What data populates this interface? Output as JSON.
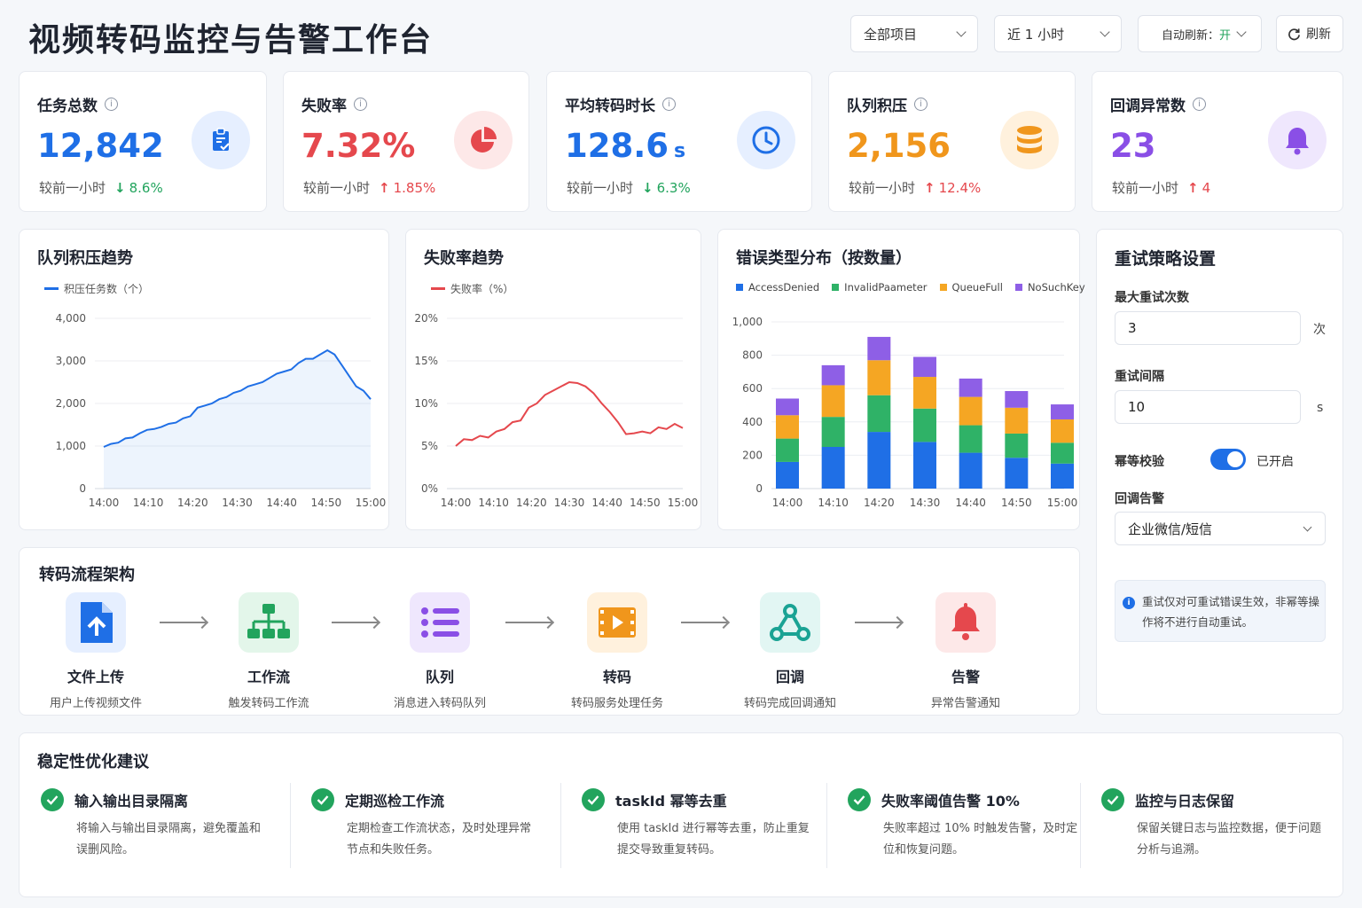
{
  "header": {
    "title": "视频转码监控与告警工作台",
    "project_select": "全部项目",
    "range_select": "近 1 小时",
    "auto_refresh_label": "自动刷新：",
    "auto_refresh_value": "开",
    "refresh_button": "刷新"
  },
  "kpis": [
    {
      "label": "任务总数",
      "value": "12,842",
      "unit": "",
      "compare": "较前一小时",
      "delta": "8.6%",
      "dir": "down",
      "color": "#1f6fe6",
      "delta_color": "#22a45d",
      "icon": "clipboard-check-icon",
      "icon_bg": "#e6efff"
    },
    {
      "label": "失败率",
      "value": "7.32%",
      "unit": "",
      "compare": "较前一小时",
      "delta": "1.85%",
      "dir": "up",
      "color": "#e5484d",
      "delta_color": "#e5484d",
      "icon": "pie-chart-icon",
      "icon_bg": "#fde8e8"
    },
    {
      "label": "平均转码时长",
      "value": "128.6",
      "unit": "s",
      "compare": "较前一小时",
      "delta": "6.3%",
      "dir": "down",
      "color": "#1f6fe6",
      "delta_color": "#22a45d",
      "icon": "clock-icon",
      "icon_bg": "#e6efff"
    },
    {
      "label": "队列积压",
      "value": "2,156",
      "unit": "",
      "compare": "较前一小时",
      "delta": "12.4%",
      "dir": "up",
      "color": "#f0961c",
      "delta_color": "#e5484d",
      "icon": "database-icon",
      "icon_bg": "#fff1dd"
    },
    {
      "label": "回调异常数",
      "value": "23",
      "unit": "",
      "compare": "较前一小时",
      "delta": "4",
      "dir": "up",
      "color": "#8a4fe6",
      "delta_color": "#e5484d",
      "icon": "bell-icon",
      "icon_bg": "#efe7fd"
    }
  ],
  "chart_data": [
    {
      "type": "area",
      "title": "队列积压趋势",
      "series": [
        {
          "name": "积压任务数（个）",
          "color": "#1f6fe6",
          "values": [
            980,
            1050,
            1080,
            1180,
            1200,
            1300,
            1380,
            1400,
            1450,
            1520,
            1550,
            1650,
            1700,
            1900,
            1950,
            2000,
            2100,
            2150,
            2250,
            2300,
            2400,
            2450,
            2500,
            2600,
            2700,
            2750,
            2800,
            2950,
            3050,
            3050,
            3150,
            3250,
            3150,
            2900,
            2650,
            2400,
            2300,
            2100
          ]
        }
      ],
      "x_ticks": [
        "14:00",
        "14:10",
        "14:20",
        "14:30",
        "14:40",
        "14:50",
        "15:00"
      ],
      "y_ticks": [
        "4,000",
        "3,000",
        "2,000",
        "1,000",
        "0"
      ],
      "ylim": [
        0,
        4000
      ]
    },
    {
      "type": "line",
      "title": "失败率趋势",
      "series": [
        {
          "name": "失败率（%）",
          "color": "#e5484d",
          "values": [
            5.0,
            5.8,
            5.7,
            6.2,
            6.0,
            6.7,
            7.0,
            7.8,
            8.0,
            9.5,
            10.0,
            11.0,
            11.5,
            12.0,
            12.5,
            12.4,
            12.0,
            11.2,
            10.0,
            9.0,
            7.8,
            6.4,
            6.5,
            6.7,
            6.5,
            7.2,
            7.0,
            7.6,
            7.1
          ]
        }
      ],
      "x_ticks": [
        "14:00",
        "14:10",
        "14:20",
        "14:30",
        "14:40",
        "14:50",
        "15:00"
      ],
      "y_ticks": [
        "20%",
        "15%",
        "10%",
        "5%",
        "0%"
      ],
      "ylim": [
        0,
        20
      ]
    },
    {
      "type": "bar",
      "title": "错误类型分布（按数量）",
      "categories": [
        "14:00",
        "14:10",
        "14:20",
        "14:30",
        "14:40",
        "14:50",
        "15:00"
      ],
      "series": [
        {
          "name": "AccessDenied",
          "color": "#1f6fe6",
          "values": [
            160,
            250,
            340,
            280,
            215,
            185,
            150
          ]
        },
        {
          "name": "InvalidPaameter",
          "color": "#2fb267",
          "values": [
            140,
            180,
            220,
            200,
            165,
            145,
            125
          ]
        },
        {
          "name": "QueueFull",
          "color": "#f5a623",
          "values": [
            140,
            190,
            210,
            190,
            170,
            155,
            140
          ]
        },
        {
          "name": "NoSuchKey",
          "color": "#8e5fe6",
          "values": [
            100,
            120,
            140,
            120,
            110,
            100,
            90
          ]
        }
      ],
      "y_ticks": [
        "1,000",
        "800",
        "600",
        "400",
        "200",
        "0"
      ],
      "ylim": [
        0,
        1000
      ]
    }
  ],
  "retry": {
    "title": "重试策略设置",
    "max_label": "最大重试次数",
    "max_value": "3",
    "max_unit": "次",
    "interval_label": "重试间隔",
    "interval_value": "10",
    "interval_unit": "s",
    "idem_label": "幂等校验",
    "idem_state": "已开启",
    "alert_label": "回调告警",
    "alert_value": "企业微信/短信",
    "note": "重试仅对可重试错误生效，非幂等操作将不进行自动重试。"
  },
  "flow": {
    "title": "转码流程架构",
    "steps": [
      {
        "name": "文件上传",
        "desc": "用户上传视频文件",
        "icon": "upload-file-icon",
        "bg": "#e6efff",
        "fg": "#1f6fe6"
      },
      {
        "name": "工作流",
        "desc": "触发转码工作流",
        "icon": "workflow-icon",
        "bg": "#e3f6ea",
        "fg": "#22a45d"
      },
      {
        "name": "队列",
        "desc": "消息进入转码队列",
        "icon": "list-icon",
        "bg": "#efe7fd",
        "fg": "#8a4fe6"
      },
      {
        "name": "转码",
        "desc": "转码服务处理任务",
        "icon": "video-icon",
        "bg": "#fff1dd",
        "fg": "#f0961c"
      },
      {
        "name": "回调",
        "desc": "转码完成回调通知",
        "icon": "webhook-icon",
        "bg": "#e2f6f3",
        "fg": "#1aa394"
      },
      {
        "name": "告警",
        "desc": "异常告警通知",
        "icon": "bell-icon",
        "bg": "#fde8e8",
        "fg": "#e5484d"
      }
    ]
  },
  "suggestions": {
    "title": "稳定性优化建议",
    "items": [
      {
        "head": "输入输出目录隔离",
        "text": "将输入与输出目录隔离，避免覆盖和误删风险。"
      },
      {
        "head": "定期巡检工作流",
        "text": "定期检查工作流状态，及时处理异常节点和失败任务。"
      },
      {
        "head": "taskId 幂等去重",
        "text": "使用 taskId 进行幂等去重，防止重复提交导致重复转码。"
      },
      {
        "head": "失败率阈值告警 10%",
        "text": "失败率超过 10% 时触发告警，及时定位和恢复问题。"
      },
      {
        "head": "监控与日志保留",
        "text": "保留关键日志与监控数据，便于问题分析与追溯。"
      }
    ]
  }
}
